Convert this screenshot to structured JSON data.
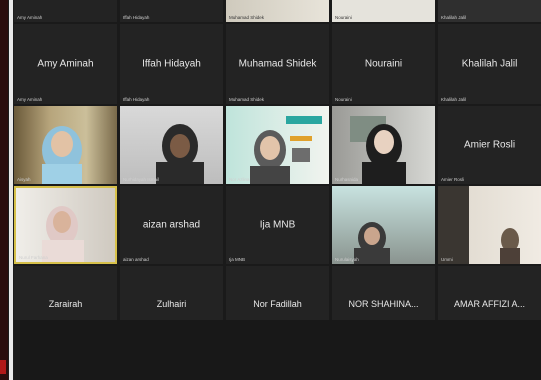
{
  "meeting": {
    "rows": [
      {
        "tiles": [
          {
            "type": "name",
            "name": "",
            "mini": "Amy Aminah"
          },
          {
            "type": "name",
            "name": "",
            "mini": "Iffah Hidayah"
          },
          {
            "type": "video",
            "name": "",
            "mini": "Muhamad Shidek",
            "bg": "#d7d3c8"
          },
          {
            "type": "video",
            "name": "",
            "mini": "Nouraini",
            "bg": "#e5e3dc"
          },
          {
            "type": "video",
            "name": "",
            "mini": "Khalilah Jalil",
            "bg": "#2f2f2f"
          }
        ]
      },
      {
        "tiles": [
          {
            "type": "name",
            "name": "Amy Aminah",
            "mini": "Amy Aminah"
          },
          {
            "type": "name",
            "name": "Iffah Hidayah",
            "mini": "Iffah Hidayah"
          },
          {
            "type": "name",
            "name": "Muhamad Shidek",
            "mini": "Muhamad Shidek"
          },
          {
            "type": "name",
            "name": "Nouraini",
            "mini": "Nouraini"
          },
          {
            "type": "name",
            "name": "Khalilah Jalil",
            "mini": "Khalilah Jalil"
          }
        ]
      },
      {
        "tiles": [
          {
            "type": "video",
            "name": "",
            "mini": "Aisyah",
            "bg": "#c9b98e"
          },
          {
            "type": "video",
            "name": "",
            "mini": "Nurhidayah Ismail",
            "bg": "#cfcfcf"
          },
          {
            "type": "video",
            "name": "",
            "mini": "Nor Azlina",
            "bg": "#dfeee9"
          },
          {
            "type": "video",
            "name": "",
            "mini": "Nurhasnida",
            "bg": "#c8c9c6"
          },
          {
            "type": "name",
            "name": "Amier Rosli",
            "mini": "Amier Rosli"
          }
        ]
      },
      {
        "tiles": [
          {
            "type": "video",
            "name": "",
            "mini": "Nurul Farhana",
            "bg": "#d6d3cd"
          },
          {
            "type": "name",
            "name": "aizan arshad",
            "mini": "aizan arshad"
          },
          {
            "type": "name",
            "name": "Ija MNB",
            "mini": "Ija MNB"
          },
          {
            "type": "video",
            "name": "",
            "mini": "Nurulaisyah",
            "bg": "#a9b7b1"
          },
          {
            "type": "video",
            "name": "",
            "mini": "Ummi",
            "bg": "#dcd7cf"
          }
        ]
      }
    ],
    "bottom_names": [
      "Zarairah",
      "Zulhairi",
      "Nor Fadillah",
      "NOR SHAHINA...",
      "AMAR AFFIZI A..."
    ]
  }
}
